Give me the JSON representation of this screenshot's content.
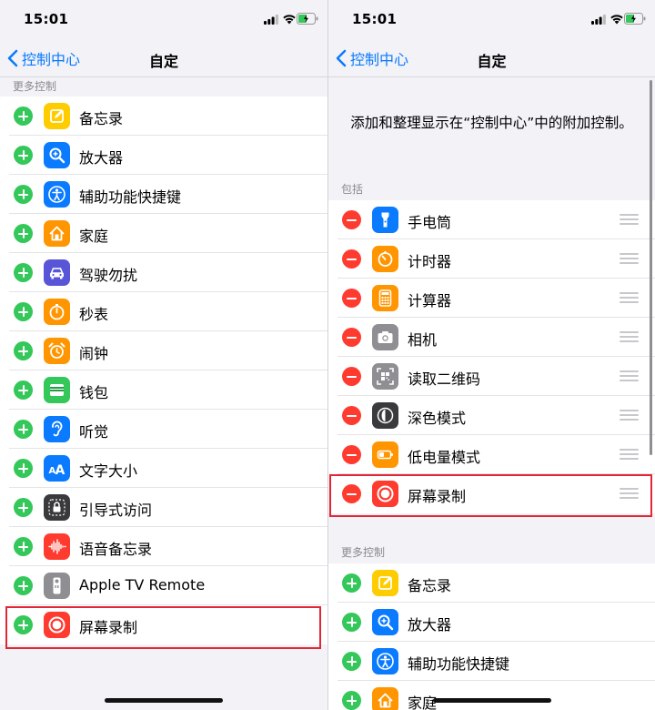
{
  "left": {
    "time": "15:01",
    "back_label": "控制中心",
    "title": "自定",
    "more_header": "更多控制",
    "items": [
      {
        "label": "备忘录",
        "icon": "notes-icon",
        "color": "#ffcc00"
      },
      {
        "label": "放大器",
        "icon": "magnifier-icon",
        "color": "#0a7aff"
      },
      {
        "label": "辅助功能快捷键",
        "icon": "accessibility-icon",
        "color": "#0a7aff"
      },
      {
        "label": "家庭",
        "icon": "home-icon",
        "color": "#ff9500"
      },
      {
        "label": "驾驶勿扰",
        "icon": "car-icon",
        "color": "#5856d6"
      },
      {
        "label": "秒表",
        "icon": "stopwatch-icon",
        "color": "#ff9500"
      },
      {
        "label": "闹钟",
        "icon": "alarm-icon",
        "color": "#ff9500"
      },
      {
        "label": "钱包",
        "icon": "wallet-icon",
        "color": "#34c759"
      },
      {
        "label": "听觉",
        "icon": "ear-icon",
        "color": "#0a7aff"
      },
      {
        "label": "文字大小",
        "icon": "text-size-icon",
        "color": "#0a7aff"
      },
      {
        "label": "引导式访问",
        "icon": "lock-icon",
        "color": "#3a3a3c"
      },
      {
        "label": "语音备忘录",
        "icon": "waveform-icon",
        "color": "#ff3b30"
      },
      {
        "label": "Apple TV Remote",
        "icon": "remote-icon",
        "color": "#8e8e93"
      },
      {
        "label": "屏幕录制",
        "icon": "record-icon",
        "color": "#ff3b30"
      }
    ]
  },
  "right": {
    "time": "15:01",
    "back_label": "控制中心",
    "title": "自定",
    "description": "添加和整理显示在“控制中心”中的附加控制。",
    "include_header": "包括",
    "included": [
      {
        "label": "手电筒",
        "icon": "flashlight-icon",
        "color": "#0a7aff"
      },
      {
        "label": "计时器",
        "icon": "timer-icon",
        "color": "#ff9500"
      },
      {
        "label": "计算器",
        "icon": "calculator-icon",
        "color": "#ff9500"
      },
      {
        "label": "相机",
        "icon": "camera-icon",
        "color": "#8e8e93"
      },
      {
        "label": "读取二维码",
        "icon": "qr-code-icon",
        "color": "#8e8e93"
      },
      {
        "label": "深色模式",
        "icon": "dark-mode-icon",
        "color": "#3a3a3c"
      },
      {
        "label": "低电量模式",
        "icon": "battery-icon",
        "color": "#ff9500"
      },
      {
        "label": "屏幕录制",
        "icon": "record-icon",
        "color": "#ff3b30"
      }
    ],
    "more_header": "更多控制",
    "more": [
      {
        "label": "备忘录",
        "icon": "notes-icon",
        "color": "#ffcc00"
      },
      {
        "label": "放大器",
        "icon": "magnifier-icon",
        "color": "#0a7aff"
      },
      {
        "label": "辅助功能快捷键",
        "icon": "accessibility-icon",
        "color": "#0a7aff"
      },
      {
        "label": "家庭",
        "icon": "home-icon",
        "color": "#ff9500"
      }
    ]
  },
  "colors": {
    "add": "#34c759",
    "remove": "#ff3b30",
    "link": "#0a7aff",
    "highlight": "#e32636"
  }
}
